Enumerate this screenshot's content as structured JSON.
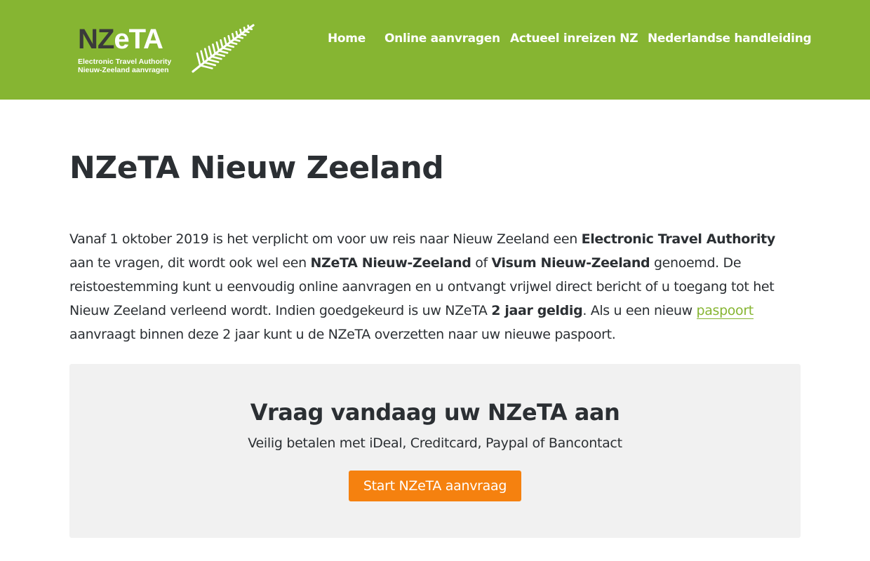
{
  "header": {
    "logo": {
      "nz": "NZ",
      "eta": "eTA",
      "line1": "Electronic Travel Authority",
      "line2": "Nieuw-Zeeland aanvragen",
      "emblem": "silver-fern-icon"
    },
    "nav": [
      {
        "label": "Home"
      },
      {
        "label": "Online aanvragen"
      },
      {
        "label": "Actueel inreizen NZ"
      },
      {
        "label": "Nederlandse handleiding"
      }
    ]
  },
  "main": {
    "title": "NZeTA Nieuw Zeeland",
    "intro": {
      "t1": "Vanaf 1 oktober 2019 is het verplicht om voor uw reis naar Nieuw Zeeland een ",
      "b1": "Electronic Travel Authority",
      "t2": " aan te vragen, dit wordt ook wel een ",
      "b2": "NZeTA Nieuw-Zeeland",
      "t3": " of ",
      "b3": "Visum Nieuw-Zeeland",
      "t4": " genoemd. De reistoestemming kunt u eenvoudig online aanvragen en u ontvangt vrijwel direct bericht of u toegang tot het Nieuw Zeeland verleend wordt. Indien goedgekeurd is uw NZeTA ",
      "b4": "2 jaar geldig",
      "t5": ". Als u een nieuw ",
      "link": "paspoort",
      "t6": " aanvraagt binnen deze 2 jaar kunt u de NZeTA overzetten naar uw nieuwe paspoort."
    },
    "cta": {
      "title": "Vraag vandaag uw NZeTA aan",
      "subtitle": "Veilig betalen met iDeal, Creditcard, Paypal of Bancontact",
      "button": "Start NZeTA aanvraag"
    }
  },
  "colors": {
    "brand_green": "#86b532",
    "button_orange": "#f5810f",
    "cta_background": "#f1f1f1",
    "text_dark": "#2b2f33"
  }
}
